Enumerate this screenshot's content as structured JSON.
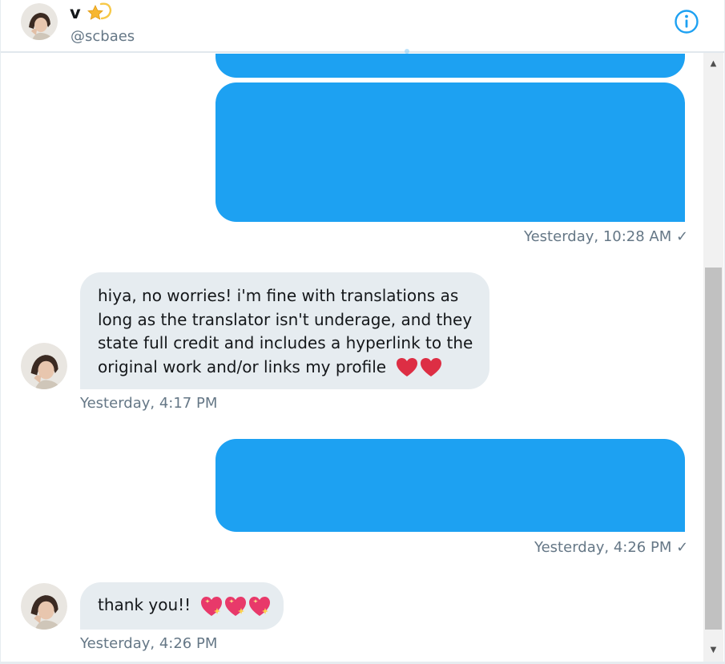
{
  "conversation": {
    "name": "v",
    "handle": "@scbaes",
    "name_emoji": "dizzy-star-icon",
    "info_icon": "info-icon"
  },
  "messages": {
    "out1": {
      "timestamp": "Yesterday, 10:28 AM ✓"
    },
    "in1": {
      "lines": [
        "hiya, no worries! i'm fine with translations as",
        "long as the translator isn't underage, and they",
        "state full credit and includes a hyperlink to the",
        "original work and/or links my profile"
      ],
      "emoji": [
        "red-heart-icon",
        "red-heart-icon"
      ],
      "timestamp": "Yesterday, 4:17 PM"
    },
    "out2": {
      "timestamp": "Yesterday, 4:26 PM ✓"
    },
    "in2": {
      "text": "thank you!!",
      "emoji": [
        "sparkling-heart-icon",
        "sparkling-heart-icon",
        "sparkling-heart-icon"
      ],
      "timestamp": "Yesterday, 4:26 PM"
    }
  },
  "colors": {
    "accent": "#1da1f2",
    "incoming_bubble": "#e6ecf0",
    "timestamp": "#657786",
    "heart": "#dd2e44"
  },
  "scrollbar": {
    "up_arrow": "▲",
    "down_arrow": "▼"
  }
}
